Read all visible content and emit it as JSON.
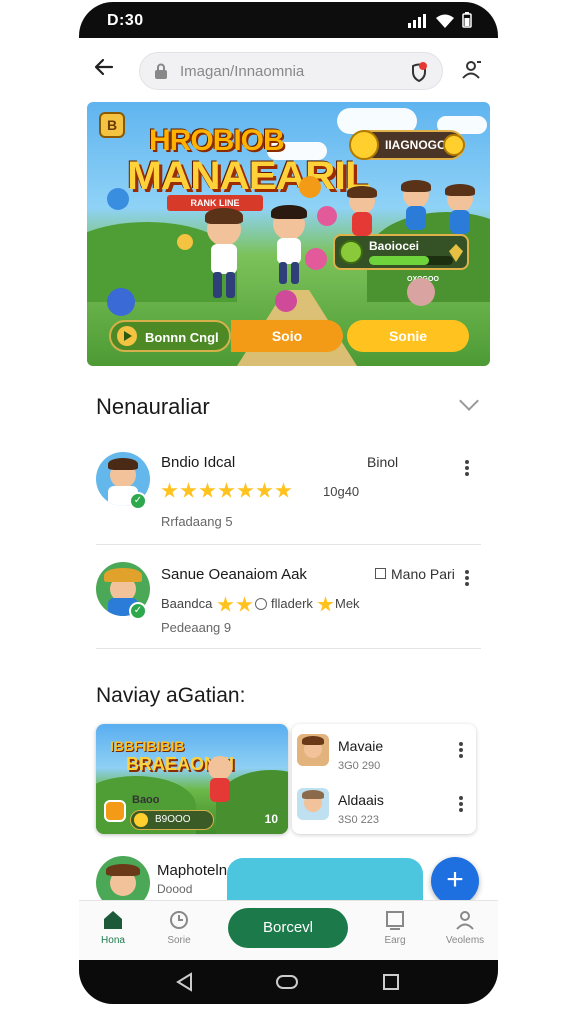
{
  "status_bar": {
    "time": "D:30"
  },
  "top_bar": {
    "search_placeholder": "Imagan/Innaomnia"
  },
  "banner": {
    "title_line1": "HROBIOB",
    "title_line2": "MANAEARIL",
    "ribbon_text": "RANK LINE",
    "badge_letter": "B",
    "coins_label": "IIAGNOGOO",
    "progress_label": "Baoiocei",
    "progress_sub": "OXOGOO",
    "progress_fraction": 0.72,
    "buttons": [
      "Bonnn Cngl",
      "Soio",
      "Sonie"
    ]
  },
  "section1": {
    "title": "Nenauraliar"
  },
  "items": [
    {
      "title": "Bndio Idcal",
      "meta": "Binol",
      "rating_text": "10g40",
      "sub": "Rrfadaang 5",
      "stars": 7
    },
    {
      "title": "Sanue Oeanaiom Aak",
      "meta": "Mano Pari",
      "rating_text": "Baandca",
      "rating_tail": "flladerk",
      "rating_tail2": "Mek",
      "sub": "Pedeaang 9",
      "stars": 2
    }
  ],
  "section2": {
    "title": "Naviay aGatian:"
  },
  "card_big": {
    "title1": "IBBFIBIBIB",
    "title2": "BRAEAONEI",
    "badge": "Baoo",
    "pill": "B9OOO",
    "count": "10"
  },
  "card_list": [
    {
      "title": "Mavaie",
      "sub": "3G0 290"
    },
    {
      "title": "Aldaais",
      "sub": "3S0 223"
    }
  ],
  "peek_item": {
    "title": "Maphoteln",
    "sub": "Doood"
  },
  "bottom_nav": {
    "items": [
      "Hona",
      "Sorie",
      "Earg",
      "Veolems"
    ],
    "center_label": "Borcevl"
  },
  "colors": {
    "accent_green": "#1c7a4a",
    "fab_blue": "#1e6fe0",
    "star_gold": "#ffc21e"
  }
}
